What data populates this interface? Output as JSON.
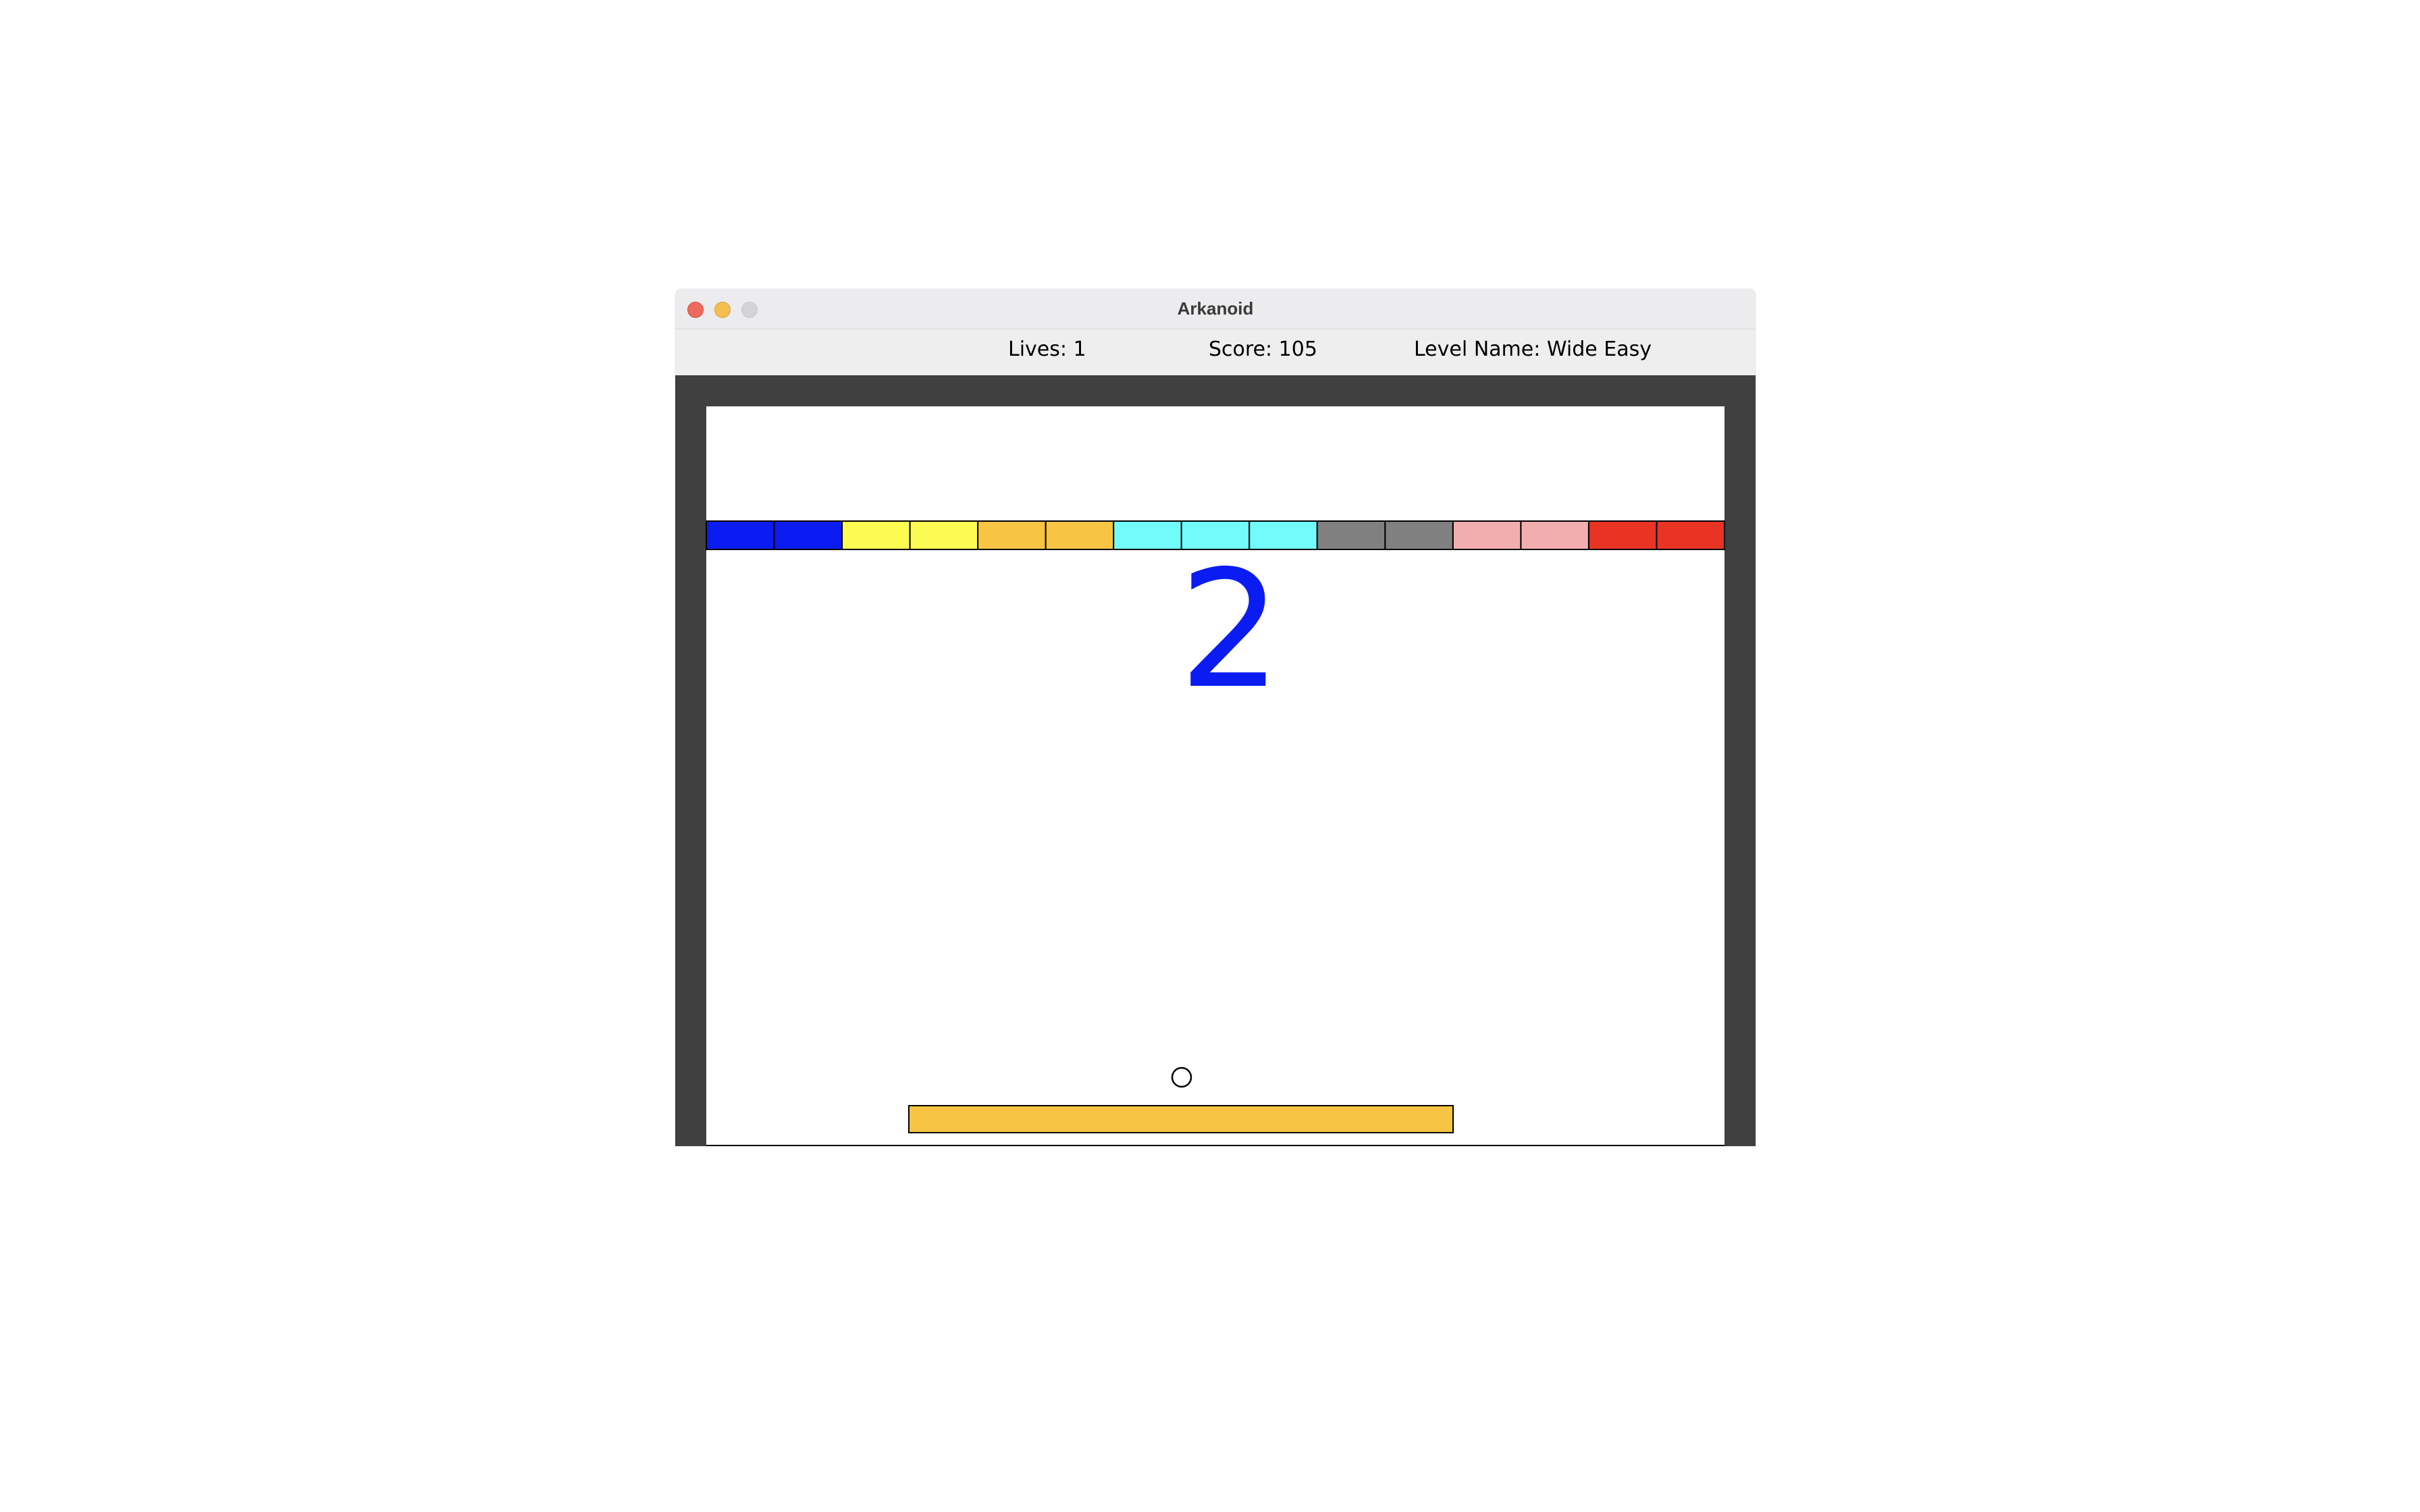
{
  "window": {
    "title": "Arkanoid"
  },
  "hud": {
    "lives": "Lives: 1",
    "score": "Score: 105",
    "level_name": "Level Name: Wide Easy"
  },
  "game": {
    "countdown": "2",
    "countdown_color": "#0a1cf2",
    "border_color": "#404040",
    "background_color": "#ffffff",
    "paddle_color": "#f7c443",
    "ball_color": "#ffffff",
    "blocks": [
      {
        "color": "#0a1cf2"
      },
      {
        "color": "#0a1cf2"
      },
      {
        "color": "#fbfb52"
      },
      {
        "color": "#fbfb52"
      },
      {
        "color": "#f7c443"
      },
      {
        "color": "#f7c443"
      },
      {
        "color": "#72fbfb"
      },
      {
        "color": "#72fbfb"
      },
      {
        "color": "#72fbfb"
      },
      {
        "color": "#808080"
      },
      {
        "color": "#808080"
      },
      {
        "color": "#f2aeae"
      },
      {
        "color": "#f2aeae"
      },
      {
        "color": "#e93424"
      },
      {
        "color": "#e93424"
      }
    ]
  },
  "traffic_lights": {
    "close_color": "#ec6a5e",
    "minimize_color": "#f4bf4f",
    "maximize_color": "#d4d3d6"
  }
}
